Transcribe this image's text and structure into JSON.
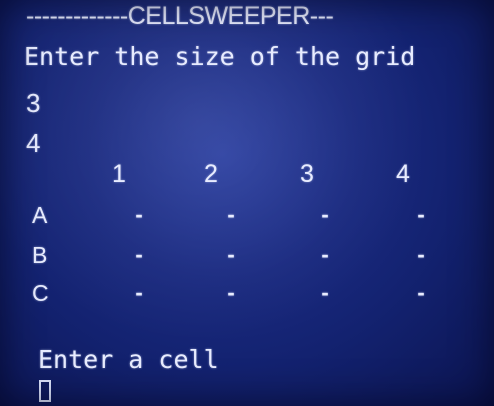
{
  "terminal": {
    "banner": "-------------CELLSWEEPER---",
    "grid_size_prompt": "Enter the size of the grid",
    "rows_input": "3",
    "cols_input": "4",
    "cell_prompt": "Enter a cell"
  },
  "grid": {
    "columns": [
      "1",
      "2",
      "3",
      "4"
    ],
    "rows": [
      {
        "label": "A",
        "cells": [
          "-",
          "-",
          "-",
          "-"
        ]
      },
      {
        "label": "B",
        "cells": [
          "-",
          "-",
          "-",
          "-"
        ]
      },
      {
        "label": "C",
        "cells": [
          "-",
          "-",
          "-",
          "-"
        ]
      }
    ]
  },
  "colors": {
    "background": "#1a2a80",
    "text": "#e8ecff"
  }
}
